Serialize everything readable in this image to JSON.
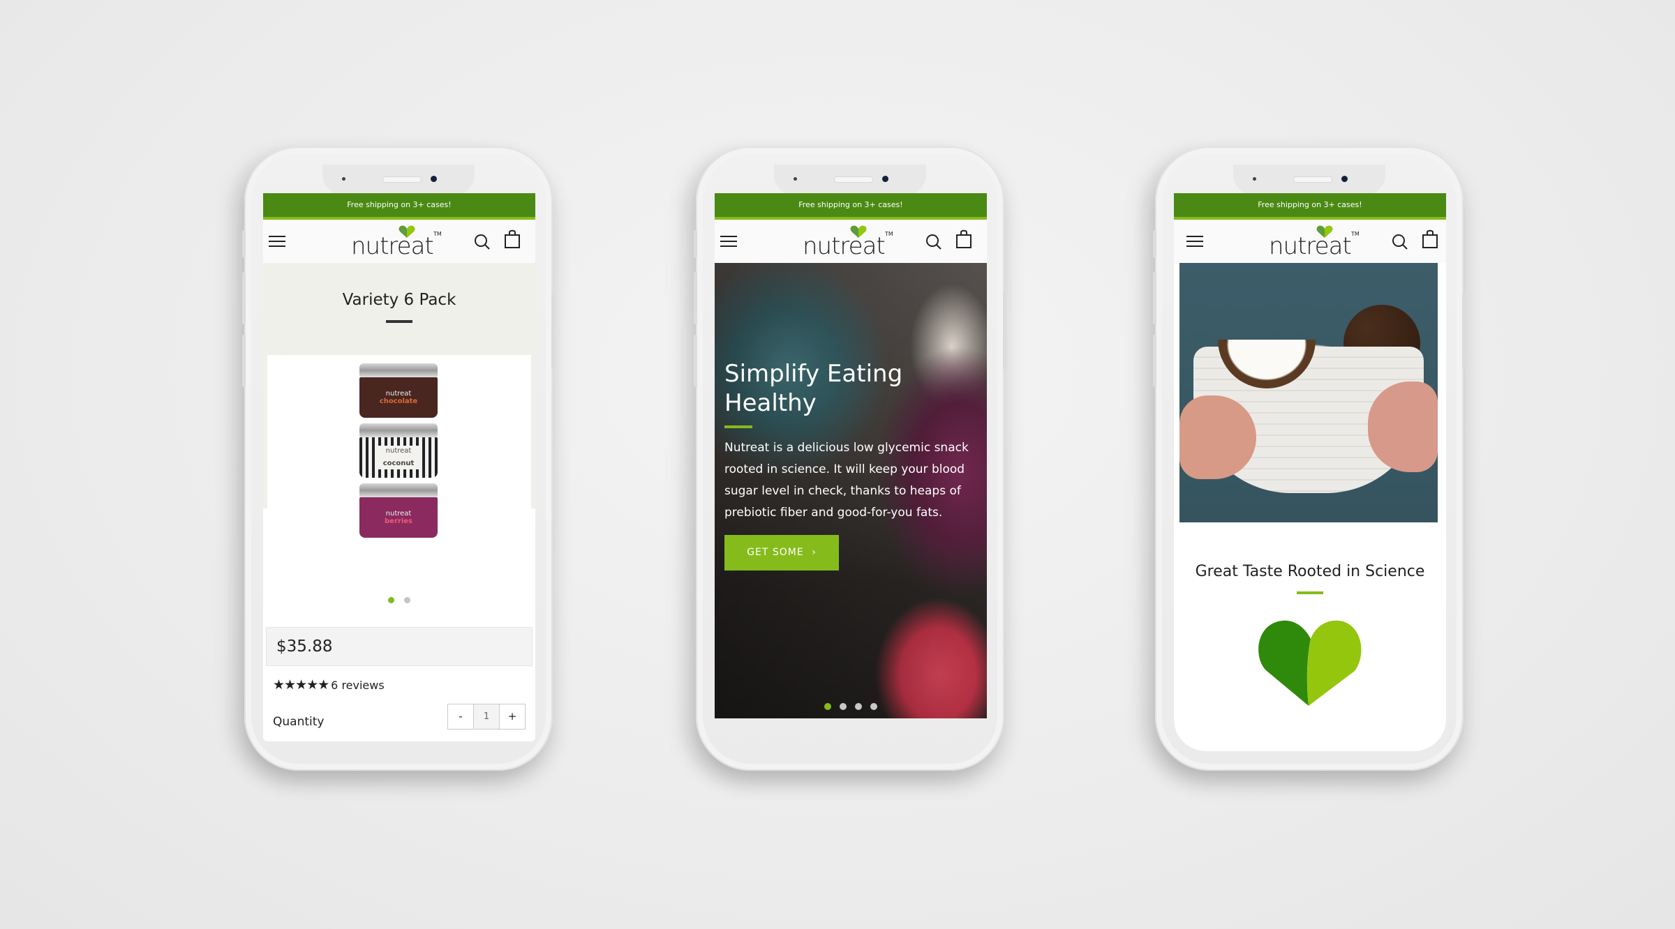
{
  "promo_banner": "Free shipping on 3+ cases!",
  "brand": {
    "name": "nutreat",
    "trademark": "TM",
    "colors": {
      "primary_green": "#4a8a14",
      "accent_green": "#85bb1b",
      "dark_heart": "#2f8a0c",
      "light_heart": "#93c60d"
    }
  },
  "nav": {
    "menu_icon": "hamburger-icon",
    "search_icon": "search-icon",
    "cart_icon": "shopping-bag-icon"
  },
  "phones": {
    "left": {
      "product_title": "Variety 6 Pack",
      "jars": [
        {
          "brand": "nutreat",
          "flavor": "chocolate"
        },
        {
          "brand": "nutreat",
          "flavor": "coconut"
        },
        {
          "brand": "nutreat",
          "flavor": "berries"
        }
      ],
      "carousel": {
        "count": 2,
        "active": 1
      },
      "price": "$35.88",
      "rating": {
        "stars": 5,
        "max": 5,
        "reviews_label": "6 reviews"
      },
      "quantity": {
        "label": "Quantity",
        "value": "1",
        "decrement": "-",
        "increment": "+"
      }
    },
    "middle": {
      "hero_title": "Simplify Eating Healthy",
      "hero_text": "Nutreat is a delicious low glycemic snack rooted in science. It will keep your blood sugar level in check, thanks to heaps of prebiotic fiber and good-for-you fats.",
      "cta_label": "GET SOME",
      "cta_icon": "chevron-right-icon",
      "carousel": {
        "count": 4,
        "active": 1
      }
    },
    "right": {
      "section_title": "Great Taste Rooted in Science",
      "illustration": "green-heart-icon"
    }
  }
}
